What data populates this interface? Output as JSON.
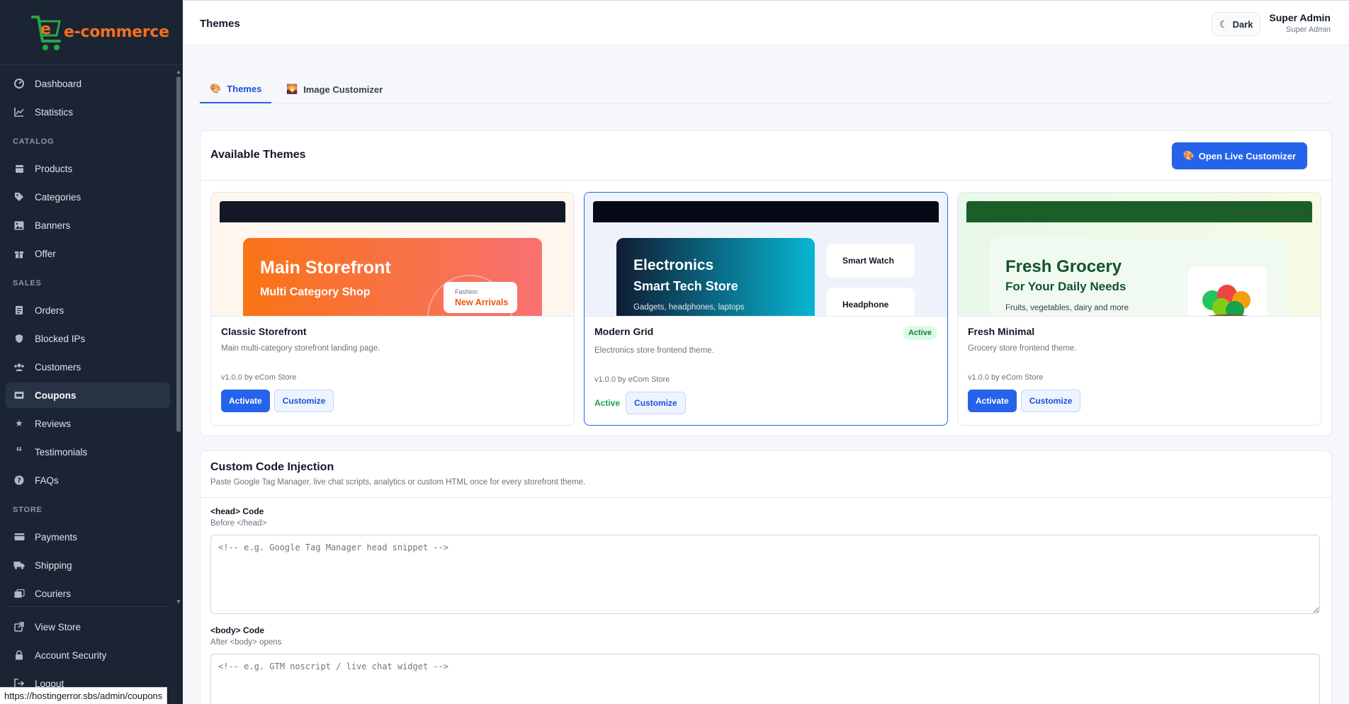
{
  "brand": {
    "logo_text": "e-commerce"
  },
  "sidebar": {
    "items": [
      {
        "label": "Dashboard",
        "icon": "dashboard-icon"
      },
      {
        "label": "Statistics",
        "icon": "chart-line-icon"
      }
    ],
    "catalog_heading": "CATALOG",
    "catalog": [
      {
        "label": "Products",
        "icon": "box-icon"
      },
      {
        "label": "Categories",
        "icon": "tag-icon"
      },
      {
        "label": "Banners",
        "icon": "image-icon"
      },
      {
        "label": "Offer",
        "icon": "gift-icon"
      }
    ],
    "sales_heading": "SALES",
    "sales": [
      {
        "label": "Orders",
        "icon": "receipt-icon"
      },
      {
        "label": "Blocked IPs",
        "icon": "shield-icon"
      },
      {
        "label": "Customers",
        "icon": "users-icon"
      },
      {
        "label": "Coupons",
        "icon": "ticket-icon"
      },
      {
        "label": "Reviews",
        "icon": "star-icon"
      },
      {
        "label": "Testimonials",
        "icon": "quote-icon"
      },
      {
        "label": "FAQs",
        "icon": "question-icon"
      }
    ],
    "store_heading": "STORE",
    "store": [
      {
        "label": "Payments",
        "icon": "wallet-icon"
      },
      {
        "label": "Shipping",
        "icon": "truck-icon"
      },
      {
        "label": "Couriers",
        "icon": "courier-icon"
      }
    ],
    "bottom": [
      {
        "label": "View Store",
        "icon": "external-link-icon"
      },
      {
        "label": "Account Security",
        "icon": "lock-icon"
      },
      {
        "label": "Logout",
        "icon": "logout-icon"
      }
    ]
  },
  "topbar": {
    "title": "Themes",
    "dark_label": "Dark",
    "user_name": "Super Admin",
    "user_role": "Super Admin"
  },
  "tabs": [
    {
      "label": "Themes",
      "emoji": "🎨"
    },
    {
      "label": "Image Customizer",
      "emoji": "🌄"
    }
  ],
  "themes_panel": {
    "title": "Available Themes",
    "open_button": "Open Live Customizer",
    "open_emoji": "🎨"
  },
  "themes": [
    {
      "name": "Classic Storefront",
      "description": "Main multi-category storefront landing page.",
      "version": "v1.0.0 by eCom Store",
      "activate_label": "Activate",
      "customize_label": "Customize",
      "preview": {
        "title": "Main Storefront",
        "subtitle": "Multi Category Shop",
        "tag_small": "Fashion",
        "tag_big": "New Arrivals"
      }
    },
    {
      "name": "Modern Grid",
      "description": "Electronics store frontend theme.",
      "version": "v1.0.0 by eCom Store",
      "badge": "Active",
      "active_label": "Active",
      "customize_label": "Customize",
      "preview": {
        "title": "Electronics",
        "subtitle": "Smart Tech Store",
        "caption": "Gadgets, headphones, laptops",
        "side1": "Smart Watch",
        "side2": "Headphone"
      }
    },
    {
      "name": "Fresh Minimal",
      "description": "Grocery store frontend theme.",
      "version": "v1.0.0 by eCom Store",
      "activate_label": "Activate",
      "customize_label": "Customize",
      "preview": {
        "title": "Fresh Grocery",
        "subtitle": "For Your Daily Needs",
        "caption": "Fruits, vegetables, dairy and more"
      }
    }
  ],
  "code_injection": {
    "title": "Custom Code Injection",
    "subtitle": "Paste Google Tag Manager, live chat scripts, analytics or custom HTML once for every storefront theme.",
    "head_label": "<head> Code",
    "head_hint": "Before </head>",
    "head_placeholder": "<!-- e.g. Google Tag Manager head snippet -->",
    "body_label": "<body> Code",
    "body_hint": "After <body> opens",
    "body_placeholder": "<!-- e.g. GTM noscript / live chat widget -->"
  },
  "status_url": "https://hostingerror.sbs/admin/coupons",
  "colors": {
    "sidebar": "#1b2433",
    "accent": "#2563eb",
    "brand_orange": "#f36f21",
    "brand_green": "#27a745",
    "active_green": "#16a34a"
  }
}
